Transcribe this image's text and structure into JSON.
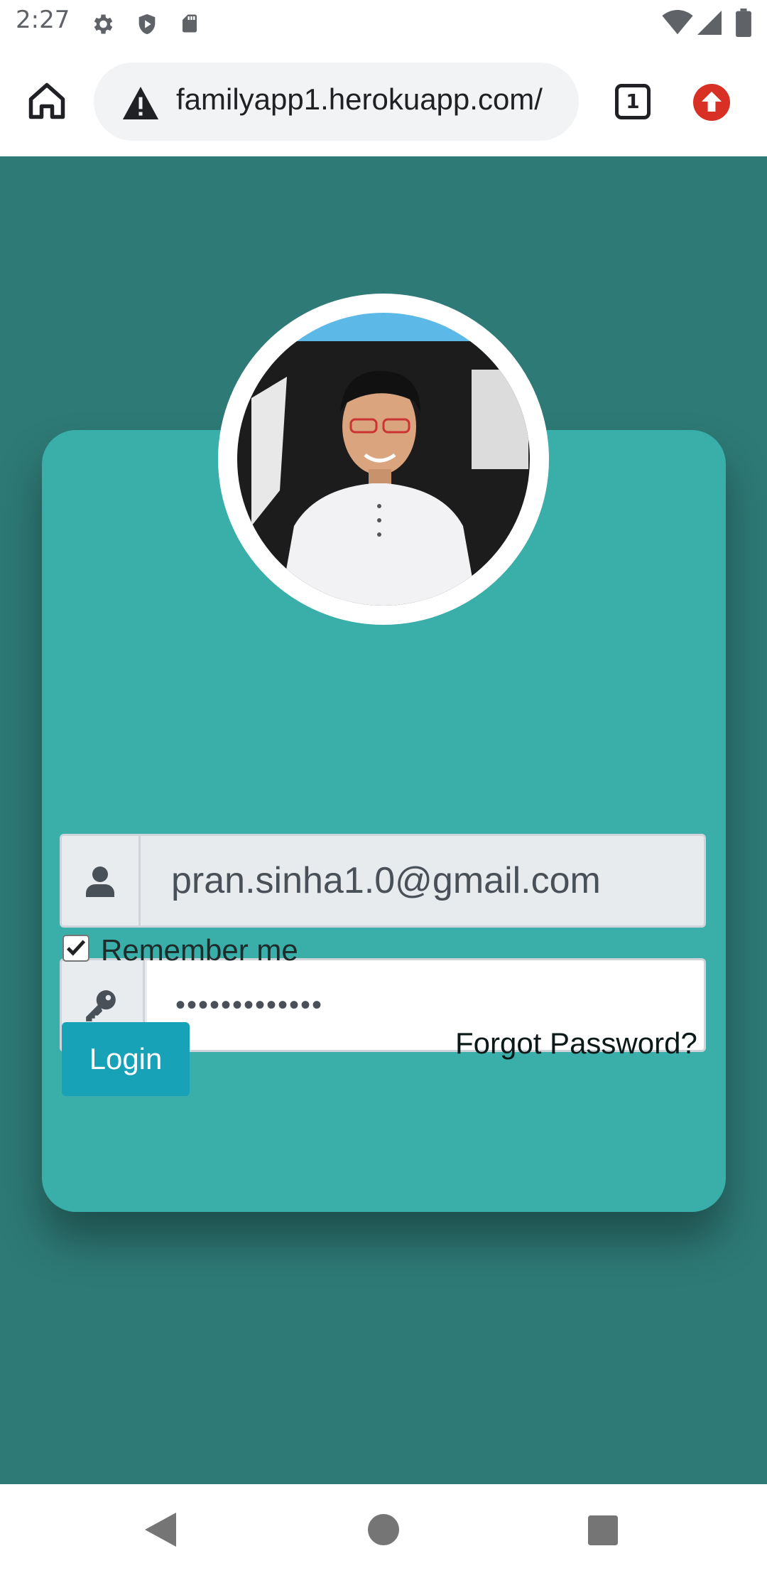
{
  "status_bar": {
    "time": "2:27",
    "icons": [
      "settings-icon",
      "shield-play-icon",
      "sd-card-icon",
      "wifi-icon",
      "signal-icon",
      "battery-icon"
    ]
  },
  "browser": {
    "url": "familyapp1.herokuapp.com/",
    "tab_count": "1",
    "icons": [
      "home-icon",
      "warning-icon",
      "tabs-icon",
      "update-icon"
    ],
    "accent_colors": {
      "update": "#d93025"
    }
  },
  "login_form": {
    "email_value": "pran.sinha1.0@gmail.com",
    "password_mask": "•••••••••••••",
    "remember_label": "Remember me",
    "remember_checked": true,
    "login_label": "Login",
    "forgot_label": "Forgot Password?",
    "colors": {
      "page_background": "#2e7a76",
      "card_background": "#3aaea9",
      "login_button": "#17a2b8"
    }
  },
  "nav_bar": {
    "icons": [
      "back-icon",
      "home-circle-icon",
      "recents-icon"
    ]
  }
}
